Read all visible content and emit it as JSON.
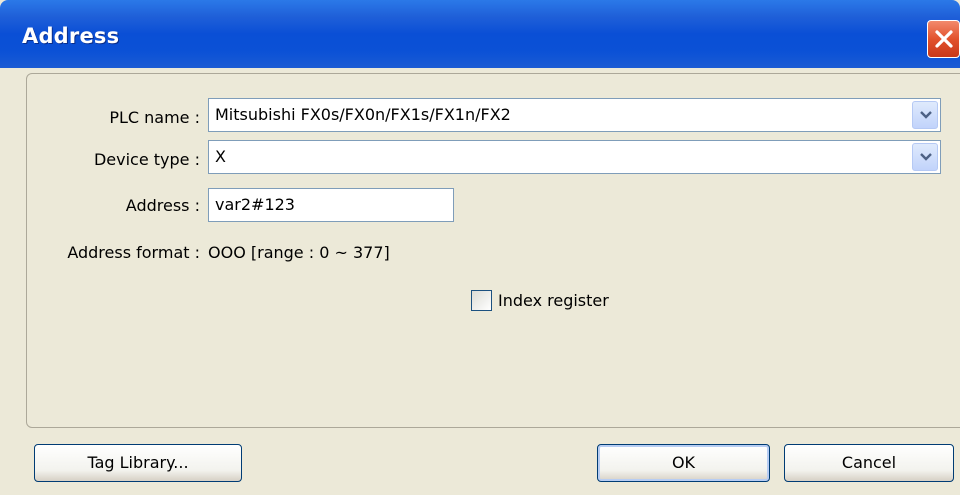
{
  "window": {
    "title": "Address"
  },
  "form": {
    "plc_name_label": "PLC name :",
    "plc_name_value": "Mitsubishi FX0s/FX0n/FX1s/FX1n/FX2",
    "device_type_label": "Device type :",
    "device_type_value": "X",
    "address_label": "Address :",
    "address_value": "var2#123",
    "address_format_label": "Address format :",
    "address_format_value": "OOO [range : 0 ~ 377]",
    "index_register_label": "Index register",
    "index_register_checked": false
  },
  "buttons": {
    "tag_library": "Tag Library...",
    "ok": "OK",
    "cancel": "Cancel"
  },
  "icons": {
    "close": "close-icon",
    "dropdown": "chevron-down-icon"
  },
  "colors": {
    "title_bar": "#0a4fd6",
    "close_button": "#e2522d",
    "dialog_background": "#ece9d8",
    "field_border": "#7f9db9"
  }
}
